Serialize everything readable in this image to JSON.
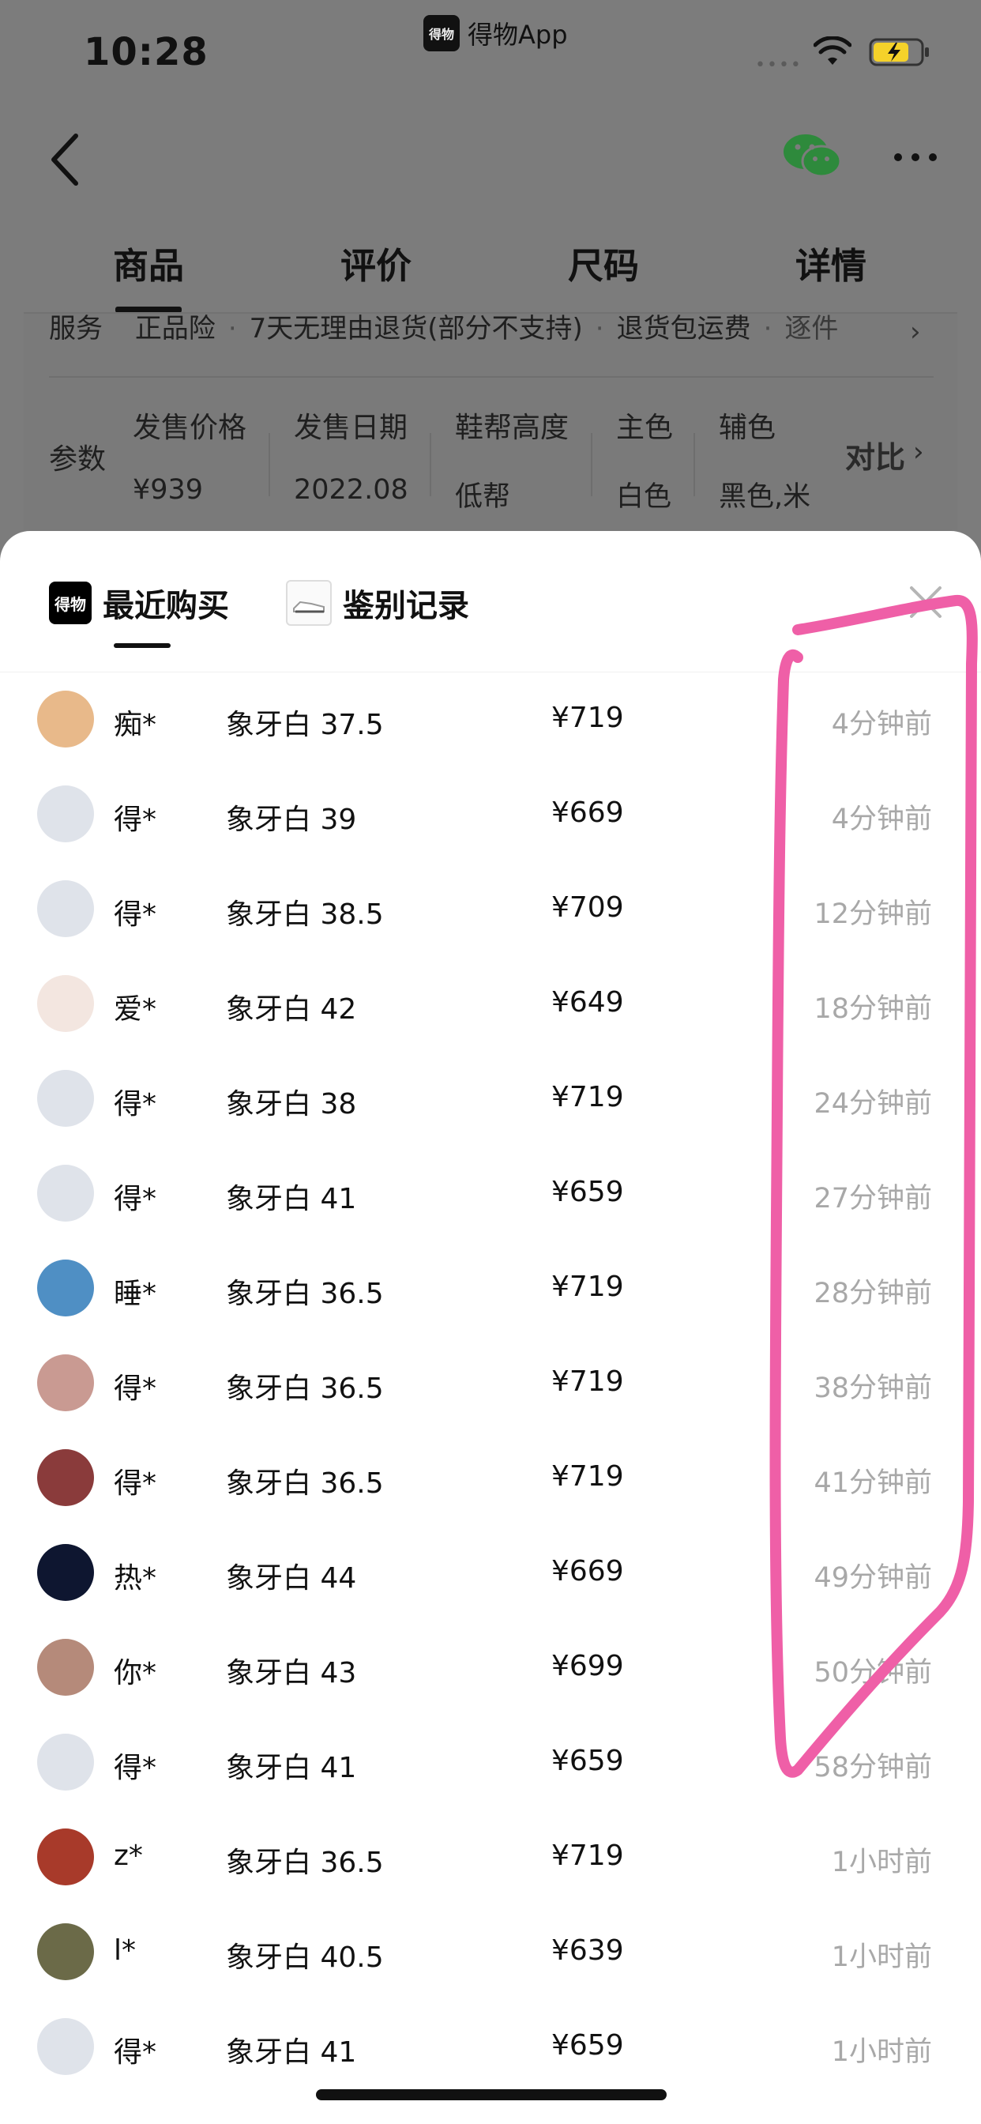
{
  "status_bar": {
    "time": "10:28",
    "app_badge": "得物",
    "app_name": "得物App"
  },
  "nav_tabs": [
    {
      "label": "商品"
    },
    {
      "label": "评价"
    },
    {
      "label": "尺码"
    },
    {
      "label": "详情"
    }
  ],
  "service": {
    "label": "服务",
    "items": [
      "正品险",
      "7天无理由退货(部分不支持)",
      "退货包运费",
      "逐件"
    ]
  },
  "params": {
    "label": "参数",
    "items": [
      {
        "key": "发售价格",
        "value": "¥939"
      },
      {
        "key": "发售日期",
        "value": "2022.08"
      },
      {
        "key": "鞋帮高度",
        "value": "低帮"
      },
      {
        "key": "主色",
        "value": "白色"
      },
      {
        "key": "辅色",
        "value": "黑色,米"
      }
    ],
    "compare_label": "对比"
  },
  "sheet": {
    "tab_recent": "最近购买",
    "tab_auth": "鉴别记录",
    "brand_icon_text": "得物"
  },
  "purchases": [
    {
      "user": "痴*",
      "spec": "象牙白 37.5",
      "price": "¥719",
      "time": "4分钟前",
      "avatar_color": "#e8b98a"
    },
    {
      "user": "得*",
      "spec": "象牙白 39",
      "price": "¥669",
      "time": "4分钟前",
      "avatar_color": "#dfe3ea"
    },
    {
      "user": "得*",
      "spec": "象牙白 38.5",
      "price": "¥709",
      "time": "12分钟前",
      "avatar_color": "#dfe3ea"
    },
    {
      "user": "爱*",
      "spec": "象牙白 42",
      "price": "¥649",
      "time": "18分钟前",
      "avatar_color": "#f3e6e0"
    },
    {
      "user": "得*",
      "spec": "象牙白 38",
      "price": "¥719",
      "time": "24分钟前",
      "avatar_color": "#dfe3ea"
    },
    {
      "user": "得*",
      "spec": "象牙白 41",
      "price": "¥659",
      "time": "27分钟前",
      "avatar_color": "#dfe3ea"
    },
    {
      "user": "睡*",
      "spec": "象牙白 36.5",
      "price": "¥719",
      "time": "28分钟前",
      "avatar_color": "#4f8fc4"
    },
    {
      "user": "得*",
      "spec": "象牙白 36.5",
      "price": "¥719",
      "time": "38分钟前",
      "avatar_color": "#c99a92"
    },
    {
      "user": "得*",
      "spec": "象牙白 36.5",
      "price": "¥719",
      "time": "41分钟前",
      "avatar_color": "#8a3b3b"
    },
    {
      "user": "热*",
      "spec": "象牙白 44",
      "price": "¥669",
      "time": "49分钟前",
      "avatar_color": "#0e1630"
    },
    {
      "user": "你*",
      "spec": "象牙白 43",
      "price": "¥699",
      "time": "50分钟前",
      "avatar_color": "#b58a7a"
    },
    {
      "user": "得*",
      "spec": "象牙白 41",
      "price": "¥659",
      "time": "58分钟前",
      "avatar_color": "#dfe3ea"
    },
    {
      "user": "z*",
      "spec": "象牙白 36.5",
      "price": "¥719",
      "time": "1小时前",
      "avatar_color": "#a83a2a"
    },
    {
      "user": "l*",
      "spec": "象牙白 40.5",
      "price": "¥639",
      "time": "1小时前",
      "avatar_color": "#6b6a48"
    },
    {
      "user": "得*",
      "spec": "象牙白 41",
      "price": "¥659",
      "time": "1小时前",
      "avatar_color": "#dfe3ea"
    }
  ],
  "colors": {
    "annotation_pink": "#ef5fa7",
    "time_gray": "#a8a8a8",
    "dim_overlay": "#7c7c7c"
  }
}
